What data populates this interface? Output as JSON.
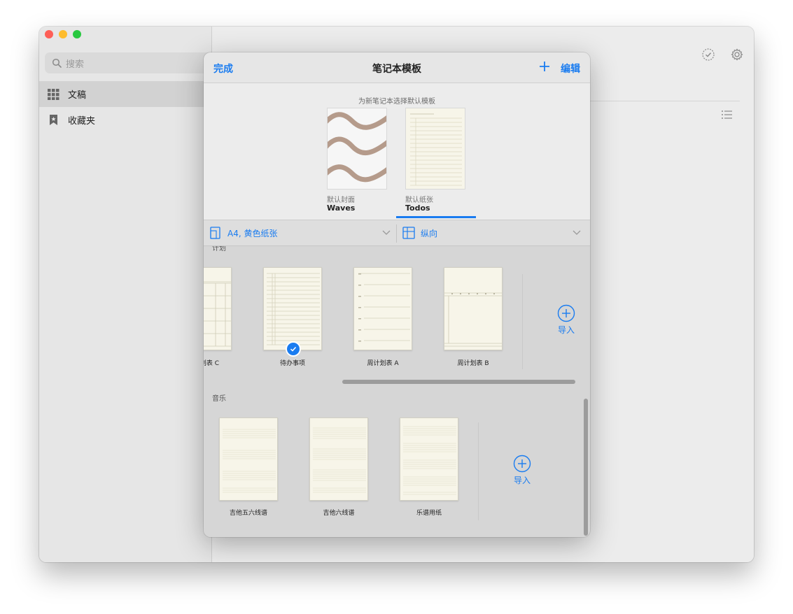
{
  "sidebar": {
    "search_placeholder": "搜索",
    "items": [
      {
        "label": "文稿",
        "icon": "grid-icon",
        "active": true
      },
      {
        "label": "收藏夹",
        "icon": "bookmark-icon",
        "active": false
      }
    ]
  },
  "main": {
    "icons": [
      "checkmark-circle-icon",
      "gear-icon",
      "list-icon"
    ]
  },
  "sheet": {
    "done_label": "完成",
    "title": "笔记本模板",
    "edit_label": "编辑",
    "defaults": {
      "caption": "为新笔记本选择默认模板",
      "cover": {
        "subtitle": "默认封面",
        "name": "Waves"
      },
      "paper": {
        "subtitle": "默认纸张",
        "name": "Todos"
      }
    },
    "paper_selector": "A4, 黄色纸张",
    "orientation_selector": "纵向",
    "sections": [
      {
        "label": "计划",
        "templates": [
          "划表 C",
          "待办事项",
          "周计划表 A",
          "周计划表 B"
        ],
        "selected": "待办事项",
        "import_label": "导入"
      },
      {
        "label": "音乐",
        "templates": [
          "吉他五六线谱",
          "吉他六线谱",
          "乐谱用纸"
        ],
        "import_label": "导入"
      }
    ]
  },
  "colors": {
    "accent": "#1a7cf0",
    "wave": "#b59b8b",
    "paper": "#f7f5e9"
  }
}
